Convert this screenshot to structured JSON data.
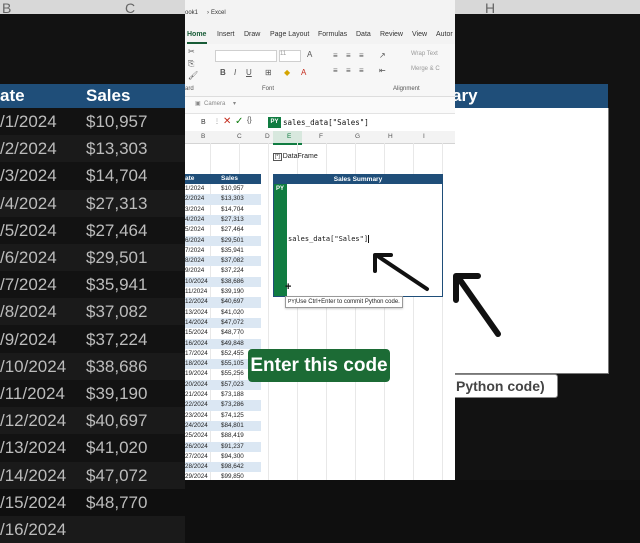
{
  "background": {
    "col_headers": [
      "B",
      "C",
      "H"
    ],
    "table_headers": {
      "date": "ate",
      "sales": "Sales"
    },
    "rows": [
      {
        "date": "/1/2024",
        "sales": "$10,957"
      },
      {
        "date": "/2/2024",
        "sales": "$13,303"
      },
      {
        "date": "/3/2024",
        "sales": "$14,704"
      },
      {
        "date": "/4/2024",
        "sales": "$27,313"
      },
      {
        "date": "/5/2024",
        "sales": "$27,464"
      },
      {
        "date": "/6/2024",
        "sales": "$29,501"
      },
      {
        "date": "/7/2024",
        "sales": "$35,941"
      },
      {
        "date": "/8/2024",
        "sales": "$37,082"
      },
      {
        "date": "/9/2024",
        "sales": "$37,224"
      },
      {
        "date": "/10/2024",
        "sales": "$38,686"
      },
      {
        "date": "/11/2024",
        "sales": "$39,190"
      },
      {
        "date": "/12/2024",
        "sales": "$40,697"
      },
      {
        "date": "/13/2024",
        "sales": "$41,020"
      },
      {
        "date": "/14/2024",
        "sales": "$47,072"
      },
      {
        "date": "/15/2024",
        "sales": "$48,770"
      },
      {
        "date": "/16/2024",
        "sales": ""
      }
    ],
    "right_header": "ary",
    "right_tip": "Python code)"
  },
  "excel": {
    "title": "ook1",
    "app": "Excel",
    "tabs": [
      "Home",
      "Insert",
      "Draw",
      "Page Layout",
      "Formulas",
      "Data",
      "Review",
      "View",
      "Autor"
    ],
    "ribbon": {
      "font_group": "Font",
      "align_group": "Alignment",
      "clipboard_group": "ard",
      "wrap_text": "Wrap Text",
      "merge_center": "Merge & C",
      "font_size": "11"
    },
    "camera_label": "Camera",
    "formula_bar": {
      "name_box": "B",
      "fn_label": "{} ",
      "py_badge": "PY",
      "formula": "sales_data[\"Sales\"]"
    },
    "columns": [
      "B",
      "C",
      "D",
      "E",
      "F",
      "G",
      "H",
      "I"
    ],
    "dataframe_label": "DataFrame",
    "data_table": {
      "headers": {
        "date": "ate",
        "sales": "Sales"
      },
      "rows": [
        {
          "date": "1/2024",
          "sales": "$10,957"
        },
        {
          "date": "2/2024",
          "sales": "$13,303"
        },
        {
          "date": "3/2024",
          "sales": "$14,704"
        },
        {
          "date": "4/2024",
          "sales": "$27,313"
        },
        {
          "date": "5/2024",
          "sales": "$27,464"
        },
        {
          "date": "6/2024",
          "sales": "$29,501"
        },
        {
          "date": "7/2024",
          "sales": "$35,941"
        },
        {
          "date": "8/2024",
          "sales": "$37,082"
        },
        {
          "date": "9/2024",
          "sales": "$37,224"
        },
        {
          "date": "10/2024",
          "sales": "$38,686"
        },
        {
          "date": "11/2024",
          "sales": "$39,190"
        },
        {
          "date": "12/2024",
          "sales": "$40,697"
        },
        {
          "date": "13/2024",
          "sales": "$41,020"
        },
        {
          "date": "14/2024",
          "sales": "$47,072"
        },
        {
          "date": "15/2024",
          "sales": "$48,770"
        },
        {
          "date": "16/2024",
          "sales": "$49,848"
        },
        {
          "date": "17/2024",
          "sales": "$52,455"
        },
        {
          "date": "18/2024",
          "sales": "$55,105"
        },
        {
          "date": "19/2024",
          "sales": "$55,256"
        },
        {
          "date": "20/2024",
          "sales": "$57,023"
        },
        {
          "date": "21/2024",
          "sales": "$73,188"
        },
        {
          "date": "22/2024",
          "sales": "$73,286"
        },
        {
          "date": "23/2024",
          "sales": "$74,125"
        },
        {
          "date": "24/2024",
          "sales": "$84,801"
        },
        {
          "date": "25/2024",
          "sales": "$88,419"
        },
        {
          "date": "26/2024",
          "sales": "$91,237"
        },
        {
          "date": "27/2024",
          "sales": "$94,300"
        },
        {
          "date": "28/2024",
          "sales": "$98,642"
        },
        {
          "date": "29/2024",
          "sales": "$99,850"
        }
      ]
    },
    "summary": {
      "title": "Sales Summary",
      "py_label": "PY",
      "code": "sales_data[\"Sales\"]",
      "hint": "Use Ctrl+Enter to commit Python code."
    }
  },
  "caption": "Enter this code",
  "colors": {
    "excel_green": "#107c41",
    "table_blue": "#1f4e79",
    "caption_bg": "#1c6b35"
  }
}
